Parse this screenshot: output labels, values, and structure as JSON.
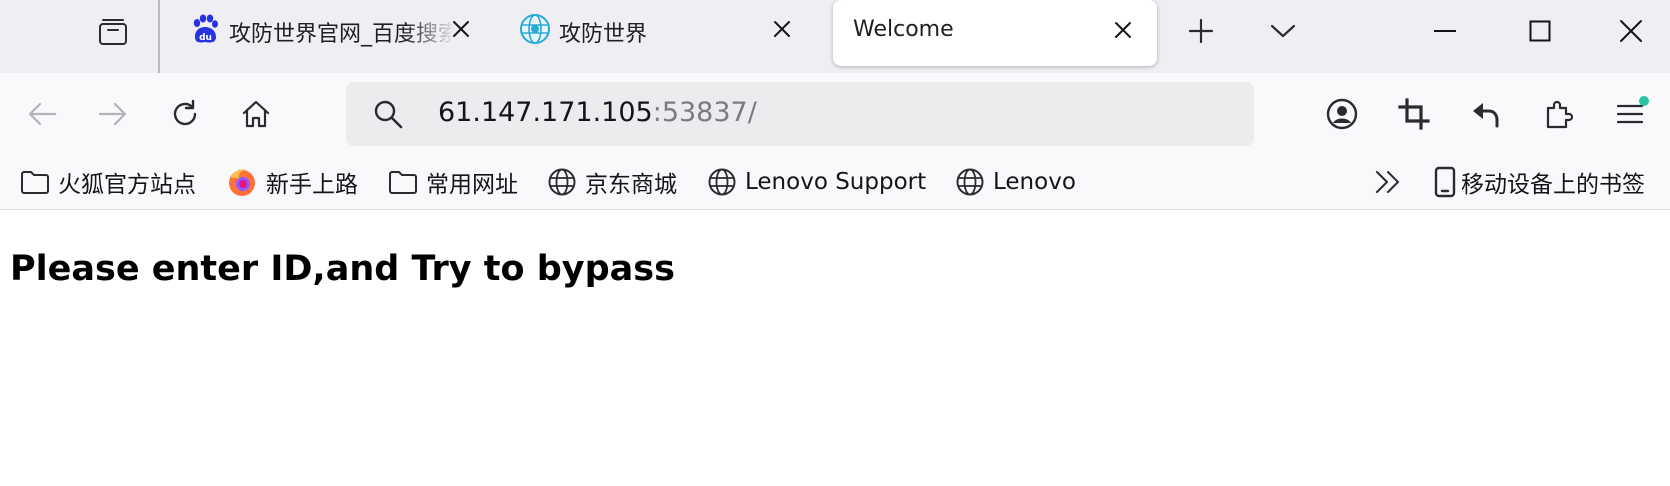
{
  "tabs": [
    {
      "title": "攻防世界官网_百度搜索",
      "favicon": "baidu-paw-icon"
    },
    {
      "title": "攻防世界",
      "favicon": "xctf-globe-icon"
    },
    {
      "title": "Welcome",
      "favicon": ""
    }
  ],
  "toolbar": {
    "url_host": "61.147.171.105",
    "url_port": ":53837/",
    "icons": [
      "back-arrow-icon",
      "forward-arrow-icon",
      "reload-icon",
      "home-icon",
      "search-icon",
      "account-icon",
      "crop-icon",
      "undo-icon",
      "extensions-icon",
      "menu-icon"
    ]
  },
  "bookmarks": [
    {
      "label": "火狐官方站点",
      "icon": "folder-icon"
    },
    {
      "label": "新手上路",
      "icon": "firefox-icon"
    },
    {
      "label": "常用网址",
      "icon": "folder-icon"
    },
    {
      "label": "京东商城",
      "icon": "globe-icon"
    },
    {
      "label": "Lenovo Support",
      "icon": "globe-icon"
    },
    {
      "label": "Lenovo",
      "icon": "globe-icon"
    }
  ],
  "mobile_bookmarks": {
    "label": "移动设备上的书签",
    "icon": "mobile-icon"
  },
  "page": {
    "heading": "Please enter ID,and Try to bypass"
  },
  "colors": {
    "tabstrip_bg": "#efeff3",
    "toolbar_bg": "#f9f9fb",
    "urlbar_bg": "#ececef",
    "notify_dot": "#2ac3a2"
  }
}
